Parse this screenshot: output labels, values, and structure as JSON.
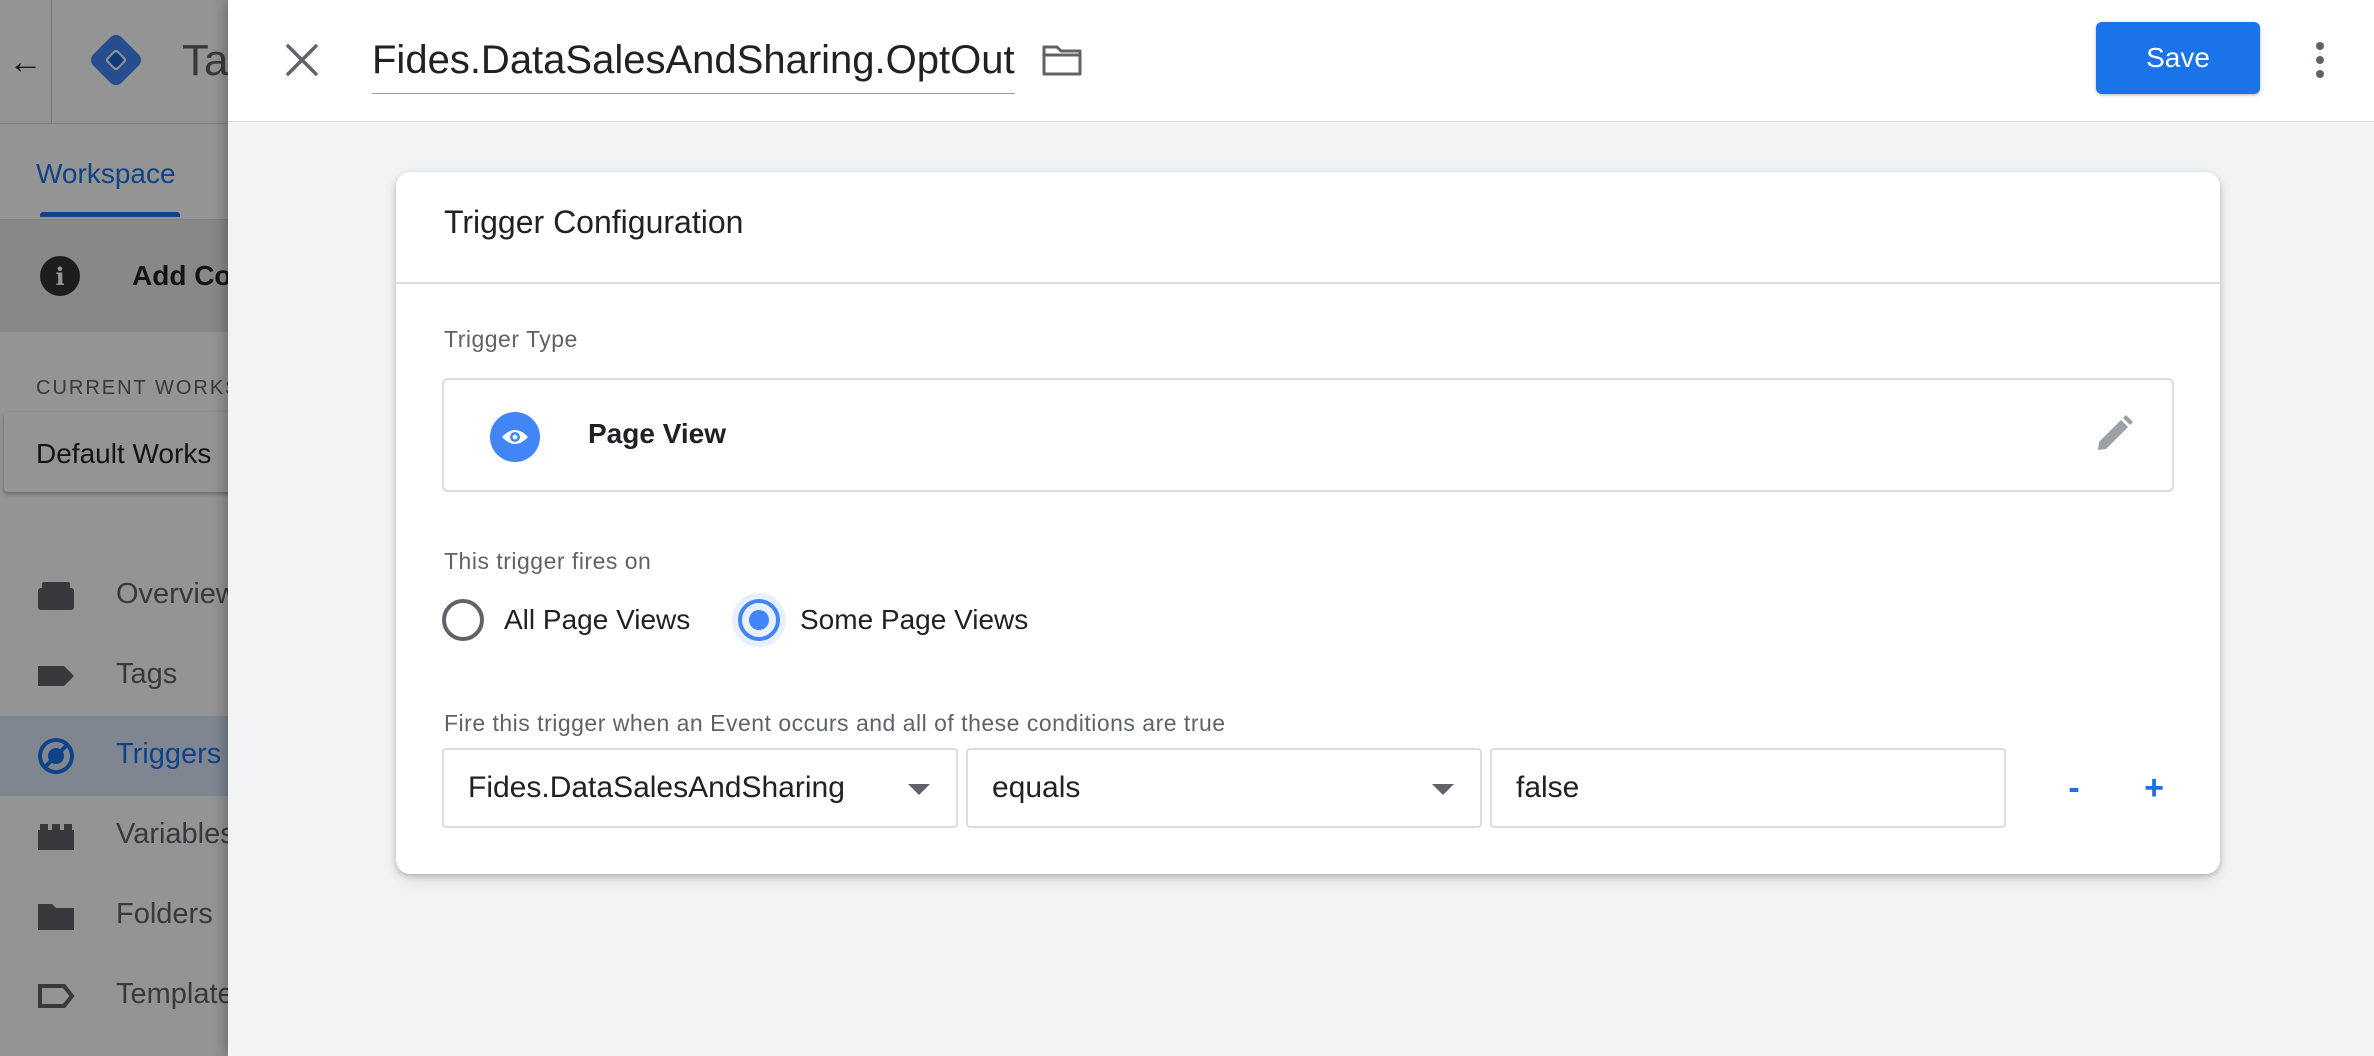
{
  "background": {
    "app_title": "Ta",
    "tab_workspace": "Workspace",
    "notice_text": "Add Co",
    "current_workspace_label": "CURRENT WORKS",
    "current_workspace_name": "Default Works",
    "nav": [
      {
        "label": "Overview",
        "icon": "briefcase-icon"
      },
      {
        "label": "Tags",
        "icon": "tag-icon"
      },
      {
        "label": "Triggers",
        "icon": "trigger-icon",
        "active": true
      },
      {
        "label": "Variables",
        "icon": "variables-icon"
      },
      {
        "label": "Folders",
        "icon": "folder-icon"
      },
      {
        "label": "Template",
        "icon": "template-icon"
      }
    ]
  },
  "header": {
    "trigger_name": "Fides.DataSalesAndSharing.OptOut",
    "save_label": "Save"
  },
  "card": {
    "title": "Trigger Configuration",
    "trigger_type_label": "Trigger Type",
    "trigger_type_name": "Page View",
    "fires_on_label": "This trigger fires on",
    "fires_on_options": [
      {
        "label": "All Page Views",
        "selected": false
      },
      {
        "label": "Some Page Views",
        "selected": true
      }
    ],
    "condition_label": "Fire this trigger when an Event occurs and all of these conditions are true",
    "condition": {
      "variable": "Fides.DataSalesAndSharing",
      "operator": "equals",
      "value": "false"
    },
    "remove_label": "-",
    "add_label": "+"
  },
  "colors": {
    "accent": "#1a73e8",
    "icon_blue": "#4285f4"
  }
}
